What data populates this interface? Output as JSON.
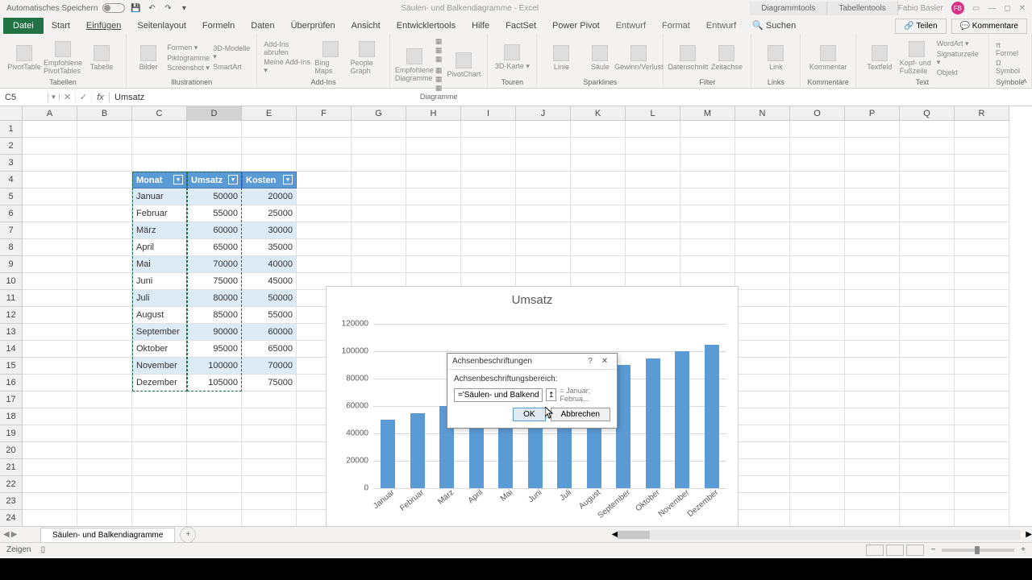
{
  "titlebar": {
    "autosave_label": "Automatisches Speichern",
    "doc_title": "Säulen- und Balkendiagramme - Excel",
    "tool_tab1": "Diagrammtools",
    "tool_tab2": "Tabellentools",
    "user_name": "Fabio Basler",
    "user_initials": "FB"
  },
  "ribbon_tabs": {
    "file": "Datei",
    "tabs": [
      "Start",
      "Einfügen",
      "Seitenlayout",
      "Formeln",
      "Daten",
      "Überprüfen",
      "Ansicht",
      "Entwicklertools",
      "Hilfe",
      "FactSet",
      "Power Pivot",
      "Entwurf",
      "Format",
      "Entwurf"
    ],
    "active_index": 1,
    "search_icon_label": "Suchen",
    "share": "Teilen",
    "comments": "Kommentare"
  },
  "ribbon_groups": {
    "g1": {
      "items": [
        "PivotTable",
        "Empfohlene PivotTables",
        "Tabelle"
      ],
      "label": "Tabellen"
    },
    "g2": {
      "items": [
        "Bilder"
      ],
      "sub": [
        "Formen ▾",
        "Piktogramme",
        "3D-Modelle ▾",
        "SmartArt",
        "Screenshot ▾"
      ],
      "label": "Illustrationen"
    },
    "g3": {
      "items": [
        "Add-Ins abrufen",
        "Meine Add-Ins ▾"
      ],
      "sub2": [
        "Bing Maps",
        "People Graph"
      ],
      "label": "Add-Ins"
    },
    "g4": {
      "items": [
        "Empfohlene Diagramme",
        "PivotChart"
      ],
      "label": "Diagramme"
    },
    "g5": {
      "items": [
        "3D-Karte ▾"
      ],
      "label": "Touren"
    },
    "g6": {
      "items": [
        "Linie",
        "Säule",
        "Gewinn/Verlust"
      ],
      "label": "Sparklines"
    },
    "g7": {
      "items": [
        "Datenschnitt",
        "Zeitachse"
      ],
      "label": "Filter"
    },
    "g8": {
      "items": [
        "Link"
      ],
      "label": "Links"
    },
    "g9": {
      "items": [
        "Kommentar"
      ],
      "label": "Kommentare"
    },
    "g10": {
      "items": [
        "Textfeld",
        "Kopf- und Fußzeile"
      ],
      "sub": [
        "WordArt ▾",
        "Signaturzeile ▾",
        "Objekt"
      ],
      "label": "Text"
    },
    "g11": {
      "items": [
        "Formel",
        "Symbol"
      ],
      "label": "Symbole"
    }
  },
  "formula_bar": {
    "name_box": "C5",
    "formula": "Umsatz"
  },
  "columns": [
    "A",
    "B",
    "C",
    "D",
    "E",
    "F",
    "G",
    "H",
    "I",
    "J",
    "K",
    "L",
    "M",
    "N",
    "O",
    "P",
    "Q",
    "R"
  ],
  "rows": 24,
  "table": {
    "header": [
      "Monat",
      "Umsatz",
      "Kosten"
    ],
    "data": [
      [
        "Januar",
        50000,
        20000
      ],
      [
        "Februar",
        55000,
        25000
      ],
      [
        "März",
        60000,
        30000
      ],
      [
        "April",
        65000,
        35000
      ],
      [
        "Mai",
        70000,
        40000
      ],
      [
        "Juni",
        75000,
        45000
      ],
      [
        "Juli",
        80000,
        50000
      ],
      [
        "August",
        85000,
        55000
      ],
      [
        "September",
        90000,
        60000
      ],
      [
        "Oktober",
        95000,
        65000
      ],
      [
        "November",
        100000,
        70000
      ],
      [
        "Dezember",
        105000,
        75000
      ]
    ]
  },
  "chart_data": {
    "type": "bar",
    "title": "Umsatz",
    "categories": [
      "Januar",
      "Februar",
      "März",
      "April",
      "Mai",
      "Juni",
      "Juli",
      "August",
      "September",
      "Oktober",
      "November",
      "Dezember"
    ],
    "values": [
      50000,
      55000,
      60000,
      65000,
      70000,
      75000,
      80000,
      85000,
      90000,
      95000,
      100000,
      105000
    ],
    "xlabel": "",
    "ylabel": "",
    "ylim": [
      0,
      120000
    ],
    "yticks": [
      0,
      20000,
      40000,
      60000,
      80000,
      100000,
      120000
    ]
  },
  "dialog": {
    "title": "Achsenbeschriftungen",
    "label": "Achsenbeschriftungsbereich:",
    "range_value": "='Säulen- und Balkendiagramme'",
    "preview_prefix": "=",
    "preview": "Januar; Februa...",
    "ok": "OK",
    "cancel": "Abbrechen"
  },
  "sheet_tabs": {
    "active": "Säulen- und Balkendiagramme"
  },
  "statusbar": {
    "mode": "Zeigen",
    "zoom": "+"
  }
}
